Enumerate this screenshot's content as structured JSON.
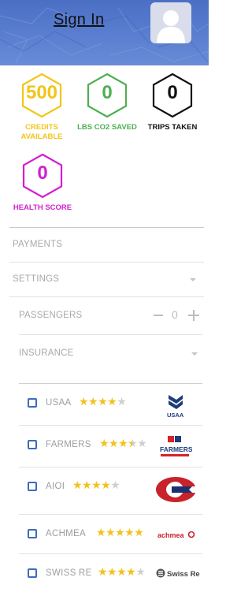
{
  "header": {
    "signin_label": "Sign In"
  },
  "stats": [
    {
      "value": "500",
      "label_line1": "CREDITS",
      "label_line2": "AVAILABLE",
      "color": "#f2c518"
    },
    {
      "value": "0",
      "label_line1": "LBS CO2 SAVED",
      "label_line2": "",
      "color": "#4caf50"
    },
    {
      "value": "0",
      "label_line1": "TRIPS TAKEN",
      "label_line2": "",
      "color": "#111111"
    },
    {
      "value": "0",
      "label_line1": "HEALTH SCORE",
      "label_line2": "",
      "color": "#d21fcf"
    }
  ],
  "menu": {
    "payments": "PAYMENTS",
    "settings": "SETTINGS",
    "passengers": "PASSENGERS",
    "passengers_count": "0",
    "insurance": "INSURANCE"
  },
  "insurers": [
    {
      "name": "USAA",
      "rating": 4,
      "logo_text": "USAA"
    },
    {
      "name": "FARMERS",
      "rating": 3.5,
      "logo_text": "FARMERS"
    },
    {
      "name": "AIOI",
      "rating": 4,
      "logo_text": ""
    },
    {
      "name": "ACHMEA",
      "rating": 5,
      "logo_text": "achmea"
    },
    {
      "name": "SWISS RE",
      "rating": 4,
      "logo_text": "Swiss Re"
    }
  ],
  "colors": {
    "header_blue": "#5579cc",
    "checkbox_blue": "#3a6cc0",
    "star_gold": "#f2c21b",
    "muted_text": "#a8a8a8"
  },
  "icons": {
    "avatar": "person-silhouette-icon",
    "minus": "minus-icon",
    "plus": "plus-icon",
    "caret": "caret-down-icon"
  }
}
